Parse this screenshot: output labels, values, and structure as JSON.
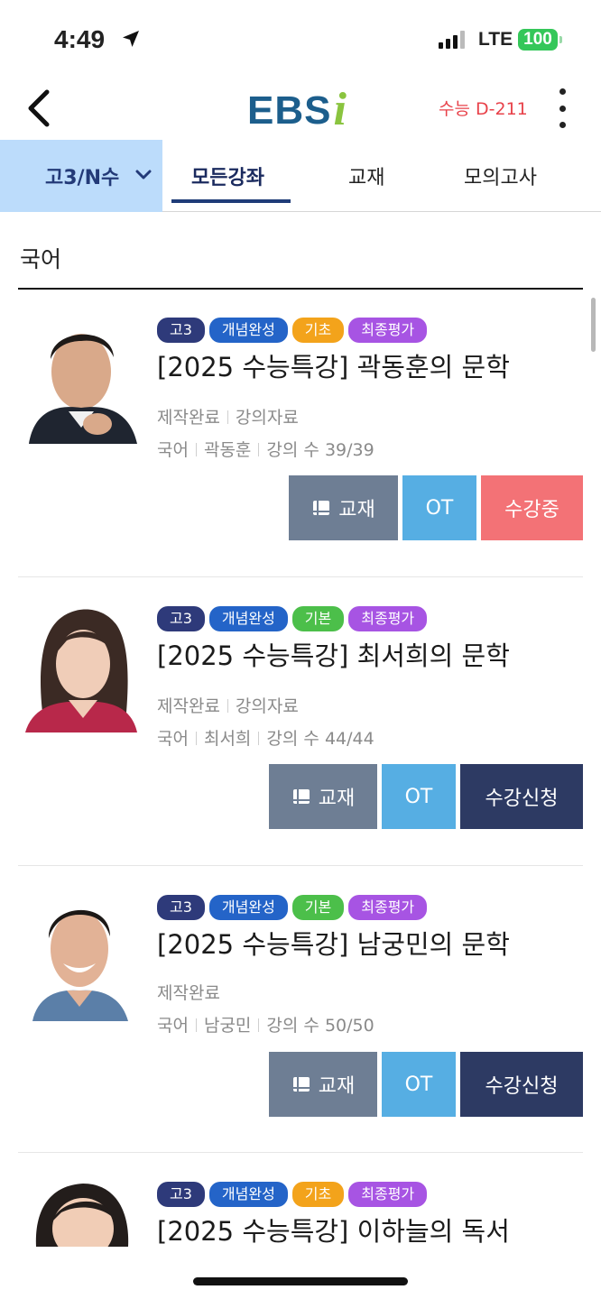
{
  "status": {
    "time": "4:49",
    "network": "LTE",
    "battery": "100"
  },
  "header": {
    "logo_main": "EBS",
    "logo_accent": "i",
    "dday": "수능 D-211"
  },
  "tabs": {
    "grade_selector": "고3/N수",
    "items": [
      "모든강좌",
      "교재",
      "모의고사"
    ],
    "active": "모든강좌"
  },
  "section": {
    "title": "국어"
  },
  "courses": [
    {
      "badges": [
        "고3",
        "개념완성",
        "기초",
        "최종평가"
      ],
      "title": "[2025 수능특강] 곽동훈의 문학",
      "status": "제작완료",
      "material": "강의자료",
      "subject": "국어",
      "teacher": "곽동훈",
      "lectures": "강의 수 39/39",
      "buttons": {
        "book": "교재",
        "ot": "OT",
        "action": "수강중"
      }
    },
    {
      "badges": [
        "고3",
        "개념완성",
        "기본",
        "최종평가"
      ],
      "title": "[2025 수능특강] 최서희의 문학",
      "status": "제작완료",
      "material": "강의자료",
      "subject": "국어",
      "teacher": "최서희",
      "lectures": "강의 수 44/44",
      "buttons": {
        "book": "교재",
        "ot": "OT",
        "action": "수강신청"
      }
    },
    {
      "badges": [
        "고3",
        "개념완성",
        "기본",
        "최종평가"
      ],
      "title": "[2025 수능특강] 남궁민의 문학",
      "status": "제작완료",
      "subject": "국어",
      "teacher": "남궁민",
      "lectures": "강의 수 50/50",
      "buttons": {
        "book": "교재",
        "ot": "OT",
        "action": "수강신청"
      }
    },
    {
      "badges": [
        "고3",
        "개념완성",
        "기초",
        "최종평가"
      ],
      "title": "[2025 수능특강] 이하늘의 독서"
    }
  ],
  "colors": {
    "grade_selector_bg": "#bcdcfb",
    "tab_active": "#1f3c78",
    "dday": "#e8424a",
    "badge_grade": "#2e3a7a",
    "badge_concept": "#2464c8",
    "badge_basic_yellow": "#f3a31b",
    "badge_basic_green": "#4cbf4a",
    "badge_final": "#a754e3",
    "btn_book": "#6e7e94",
    "btn_ot": "#56aee3",
    "btn_enrolled": "#f37276",
    "btn_apply": "#2d3a63"
  },
  "icons": [
    "location-arrow-icon",
    "signal-icon",
    "back-chevron-icon",
    "kebab-menu-icon",
    "chevron-down-icon",
    "book-icon"
  ]
}
